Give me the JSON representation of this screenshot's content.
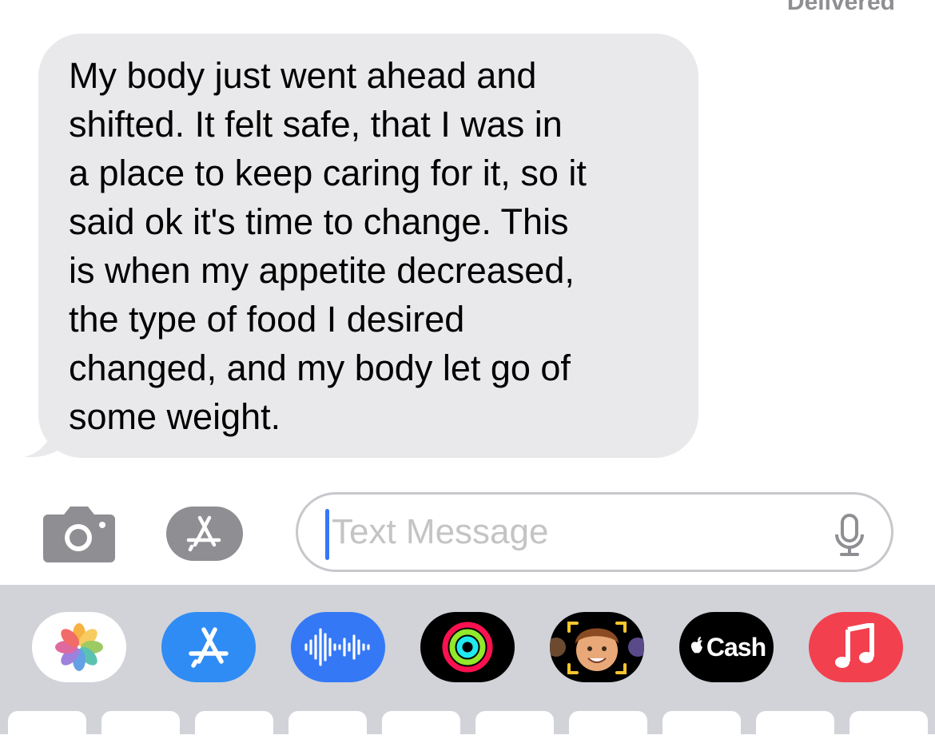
{
  "status": {
    "delivered": "Delivered"
  },
  "message": {
    "text": "My body just went ahead and\nshifted.  It felt safe, that I was in\na place to keep caring for it, so it\nsaid ok it's time to change.  This\nis when my appetite decreased,\nthe type of food I desired\nchanged, and my body let go of\nsome weight."
  },
  "composer": {
    "placeholder": "Text Message",
    "icons": [
      "camera-icon",
      "app-store-icon",
      "microphone-icon"
    ]
  },
  "app_tray": {
    "apps": [
      {
        "name": "Photos",
        "icon": "photos-icon",
        "bg": "#ffffff"
      },
      {
        "name": "App Store",
        "icon": "app-store-icon",
        "bg": "#2f8cf4"
      },
      {
        "name": "Audio",
        "icon": "audio-waveform-icon",
        "bg": "#3478f6"
      },
      {
        "name": "Fitness",
        "icon": "activity-rings-icon",
        "bg": "#000000"
      },
      {
        "name": "Memoji",
        "icon": "memoji-icon",
        "bg": "#000000"
      },
      {
        "name": "Cash",
        "label": "Cash",
        "icon": "apple-cash-icon",
        "bg": "#000000"
      },
      {
        "name": "Music",
        "icon": "music-note-icon",
        "bg": "#f2404f"
      }
    ]
  },
  "colors": {
    "bubble": "#e9e9eb",
    "tray": "#d1d3d9",
    "cursor": "#3478f6",
    "icon_gray": "#8e8e93"
  }
}
